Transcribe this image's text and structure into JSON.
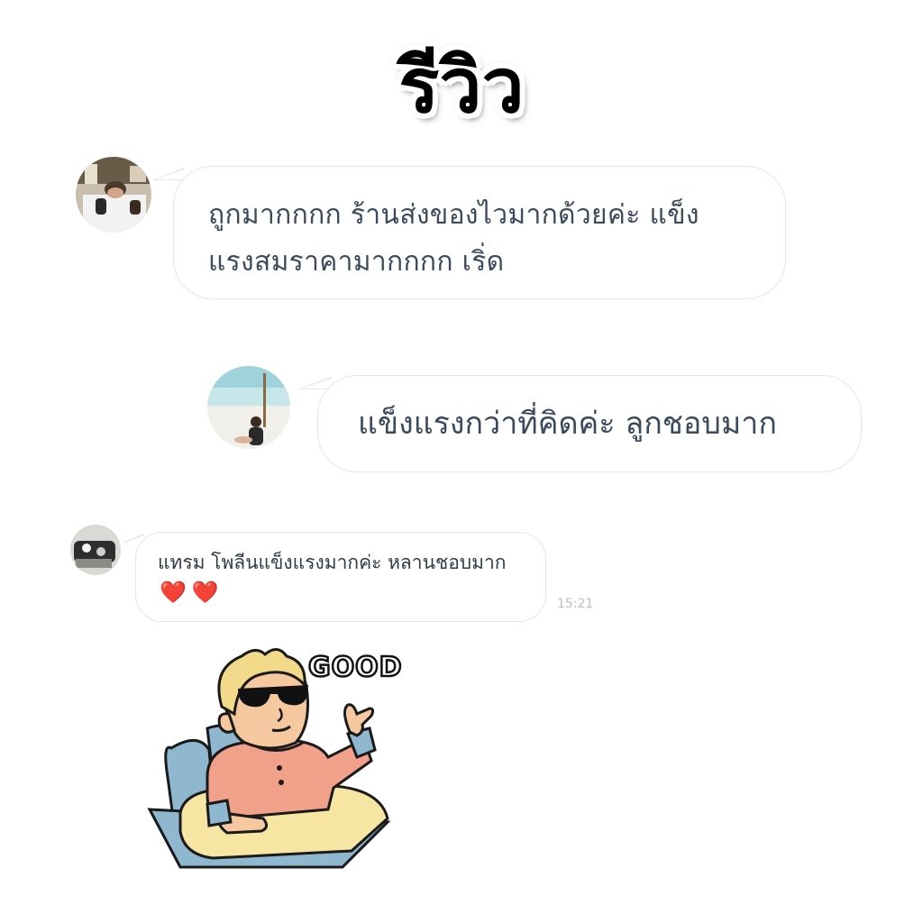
{
  "header": {
    "title": "รีวิว"
  },
  "messages": [
    {
      "text": "ถูกมากกกก ร้านส่งของไวมากด้วยค่ะ แข็งแรงสมราคามากกกก เริ่ด",
      "line1": "ถูกมากกกก ร้านส่งของไวมากด้วยค่ะ แข็ง",
      "line2": "แรงสมราคามากกกก เริ่ด"
    },
    {
      "text": "แข็งแรงกว่าที่คิดค่ะ ลูกชอบมาก"
    },
    {
      "text": "แทรม โพลีนแข็งแรงมากค่ะ หลานชอบมาก",
      "emoji": "❤️❤️",
      "time": "15:21"
    }
  ],
  "sticker": {
    "caption": "GOOD",
    "icon": "baby-sunglasses-sticker"
  },
  "colors": {
    "bubble_border": "#e3e6ea",
    "text": "#3b4a5c",
    "time": "#b9c0c7",
    "heart": "#e0262b"
  }
}
